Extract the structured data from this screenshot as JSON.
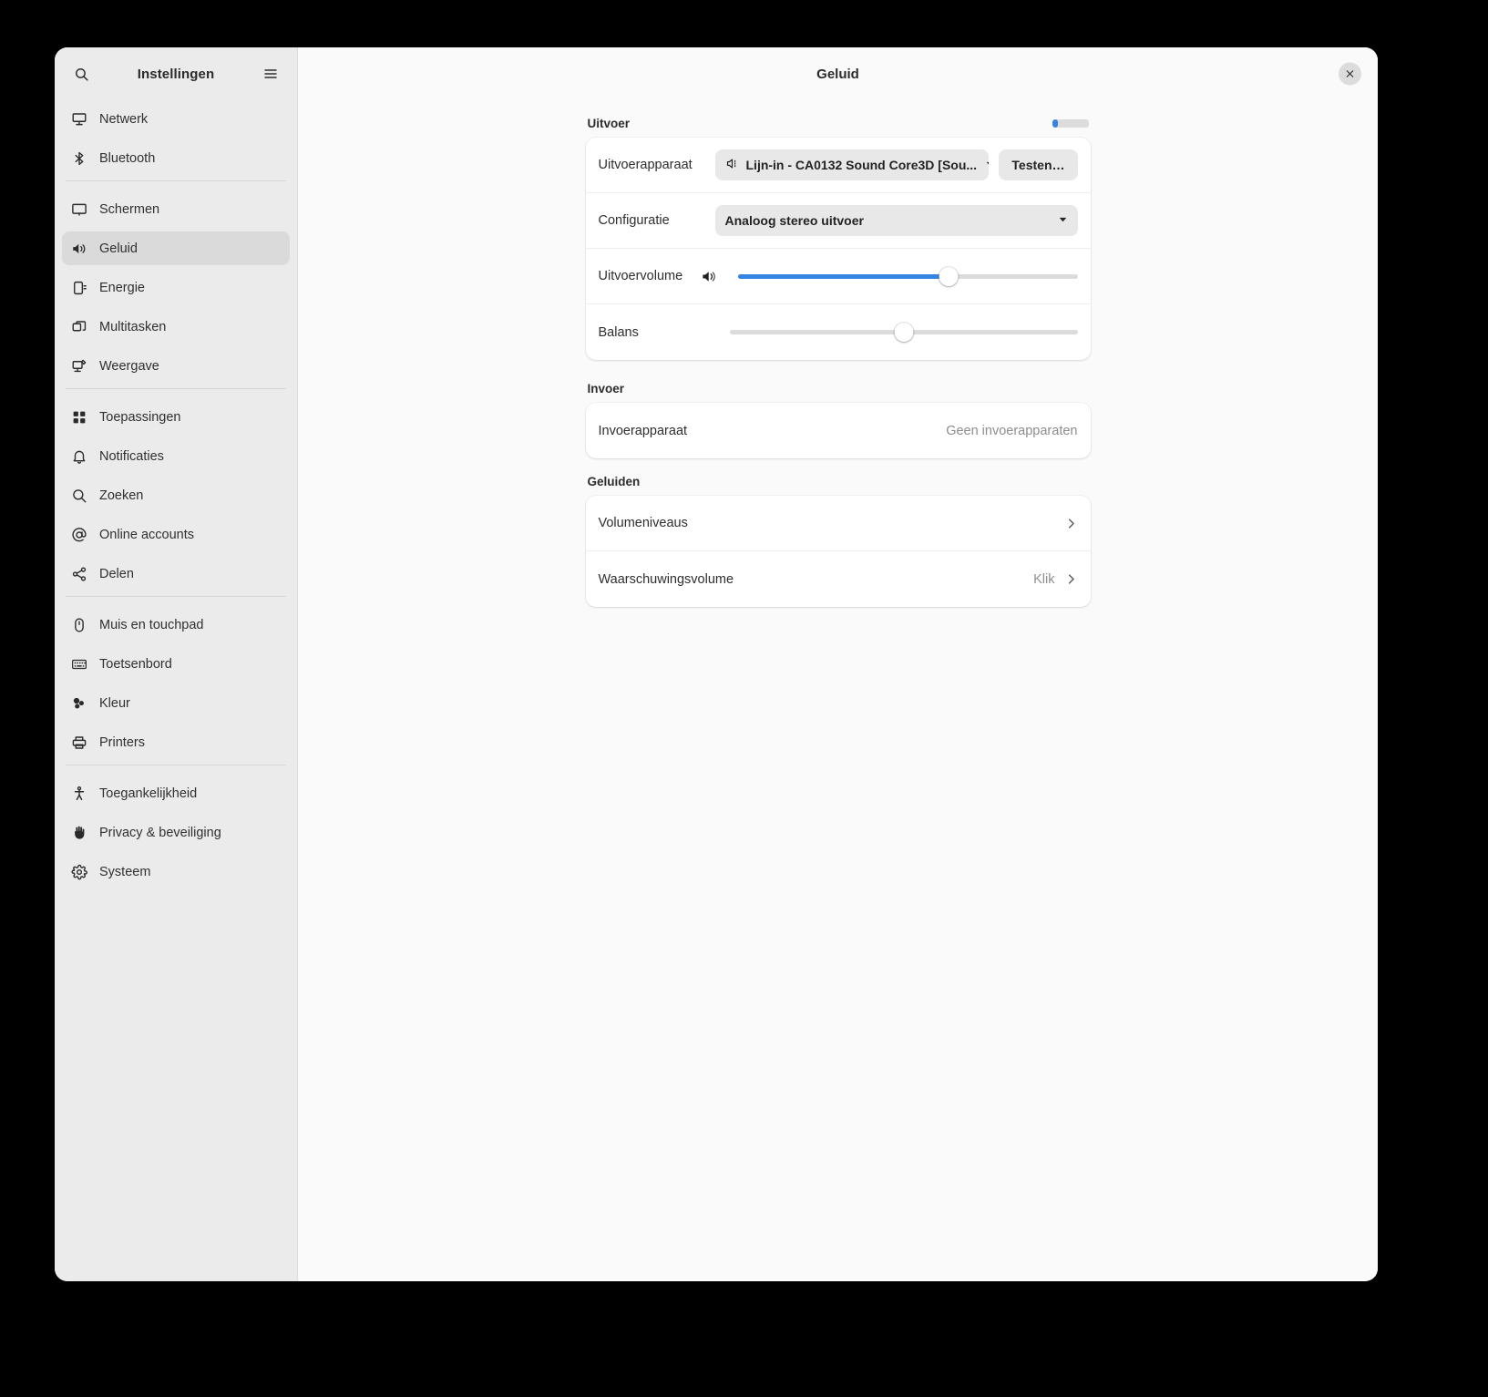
{
  "window": {
    "main_title": "Geluid",
    "close_icon": "close-icon"
  },
  "sidebar": {
    "title": "Instellingen",
    "search_icon": "search-icon",
    "menu_icon": "hamburger-menu-icon",
    "groups": [
      {
        "items": [
          {
            "label": "Netwerk",
            "icon": "network-computer-icon",
            "selected": false
          },
          {
            "label": "Bluetooth",
            "icon": "bluetooth-icon",
            "selected": false
          }
        ]
      },
      {
        "items": [
          {
            "label": "Schermen",
            "icon": "display-monitor-icon",
            "selected": false
          },
          {
            "label": "Geluid",
            "icon": "speaker-sound-icon",
            "selected": true
          },
          {
            "label": "Energie",
            "icon": "power-battery-icon",
            "selected": false
          },
          {
            "label": "Multitasken",
            "icon": "windows-multitask-icon",
            "selected": false
          },
          {
            "label": "Weergave",
            "icon": "appearance-brush-icon",
            "selected": false
          }
        ]
      },
      {
        "items": [
          {
            "label": "Toepassingen",
            "icon": "apps-grid-icon",
            "selected": false
          },
          {
            "label": "Notificaties",
            "icon": "bell-icon",
            "selected": false
          },
          {
            "label": "Zoeken",
            "icon": "search-icon",
            "selected": false
          },
          {
            "label": "Online accounts",
            "icon": "at-sign-icon",
            "selected": false
          },
          {
            "label": "Delen",
            "icon": "share-nodes-icon",
            "selected": false
          }
        ]
      },
      {
        "items": [
          {
            "label": "Muis en touchpad",
            "icon": "mouse-icon",
            "selected": false
          },
          {
            "label": "Toetsenbord",
            "icon": "keyboard-icon",
            "selected": false
          },
          {
            "label": "Kleur",
            "icon": "color-palette-icon",
            "selected": false
          },
          {
            "label": "Printers",
            "icon": "printer-icon",
            "selected": false
          }
        ]
      },
      {
        "items": [
          {
            "label": "Toegankelijkheid",
            "icon": "accessibility-person-icon",
            "selected": false
          },
          {
            "label": "Privacy & beveiliging",
            "icon": "hand-shield-icon",
            "selected": false
          },
          {
            "label": "Systeem",
            "icon": "gear-icon",
            "selected": false
          }
        ]
      }
    ]
  },
  "output": {
    "section_title": "Uitvoer",
    "level_meter": {
      "name": "output-level-meter",
      "value_percent": 17
    },
    "device_label": "Uitvoerapparaat",
    "device_value": "Lijn-in - CA0132 Sound Core3D [Sou...",
    "device_icon": "line-in-port-icon",
    "test_button": "Testen…",
    "config_label": "Configuratie",
    "config_value": "Analoog stereo uitvoer",
    "volume_label": "Uitvoervolume",
    "volume_icon": "speaker-volume-icon",
    "volume_percent": 62,
    "balance_label": "Balans",
    "balance_percent": 50
  },
  "input": {
    "section_title": "Invoer",
    "device_label": "Invoerapparaat",
    "device_value": "Geen invoerapparaten"
  },
  "sounds": {
    "section_title": "Geluiden",
    "rows": [
      {
        "label": "Volumeniveaus",
        "value": "",
        "chevron": "chevron-right-icon"
      },
      {
        "label": "Waarschuwingsvolume",
        "value": "Klik",
        "chevron": "chevron-right-icon"
      }
    ]
  },
  "colors": {
    "accent": "#3584e4",
    "sidebar_bg": "#ebebeb",
    "content_bg": "#fafafa"
  }
}
